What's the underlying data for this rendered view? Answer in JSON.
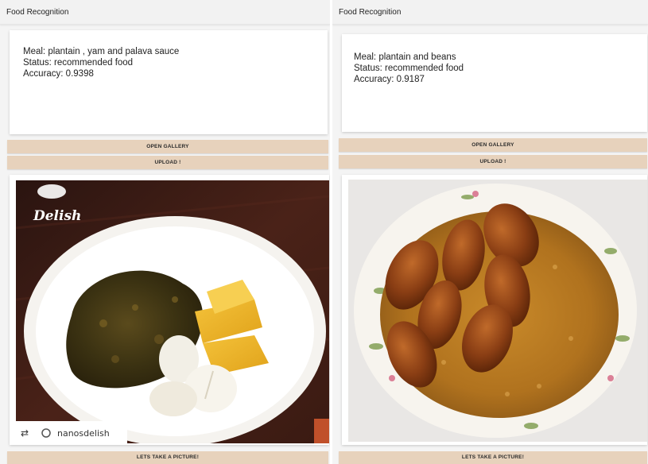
{
  "screens": [
    {
      "app_title": "Food Recognition",
      "result": {
        "meal": "Meal: plantain , yam and palava sauce",
        "status": "Status: recommended food",
        "accuracy": "Accuracy: 0.9398"
      },
      "buttons": {
        "open_gallery": "OPEN GALLERY",
        "upload": "UPLOAD !",
        "take_picture": "LETS TAKE A PICTURE!"
      },
      "photo": {
        "logo_text": "Delish",
        "watermark_handle": "nanosdelish"
      }
    },
    {
      "app_title": "Food Recognition",
      "result": {
        "meal": "Meal: plantain and beans",
        "status": "Status: recommended food",
        "accuracy": "Accuracy: 0.9187"
      },
      "buttons": {
        "open_gallery": "OPEN GALLERY",
        "upload": "UPLOAD !",
        "take_picture": "LETS TAKE A PICTURE!"
      }
    }
  ],
  "colors": {
    "button_bg": "#e7d2bc",
    "app_bar_bg": "#f2f2f2",
    "card_bg": "#ffffff"
  }
}
